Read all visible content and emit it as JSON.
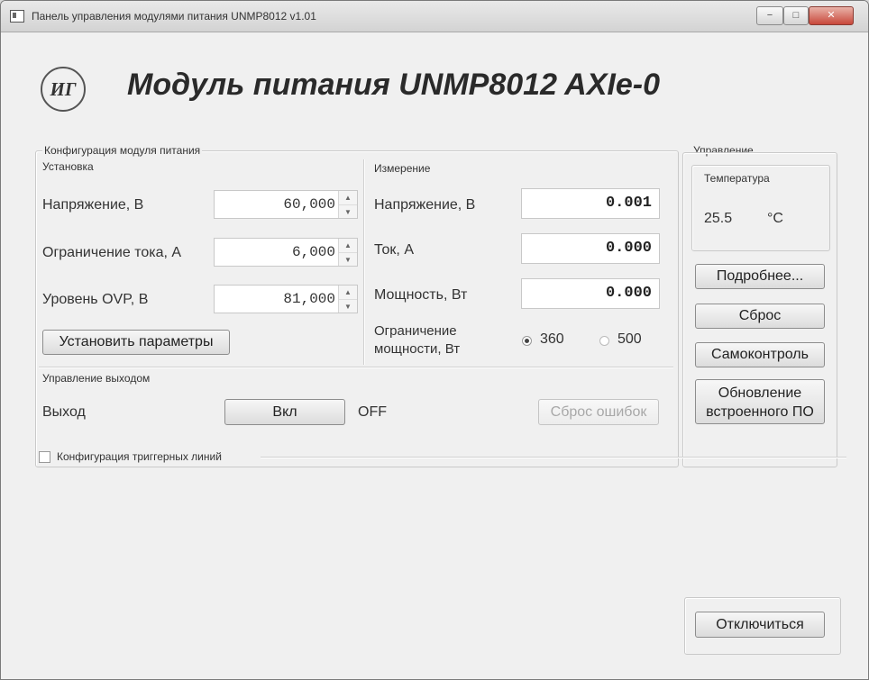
{
  "window": {
    "title": "Панель управления модулями питания UNMP8012 v1.01",
    "minimize_glyph": "−",
    "maximize_glyph": "□",
    "close_glyph": "✕"
  },
  "header": {
    "logo_text": "ИГ",
    "title": "Модуль питания UNMP8012 AXIe-0"
  },
  "config": {
    "group_label": "Конфигурация модуля питания",
    "setup": {
      "label": "Установка",
      "voltage_label": "Напряжение, В",
      "voltage_value": "60,000",
      "current_limit_label": "Ограничение тока, А",
      "current_limit_value": "6,000",
      "ovp_label": "Уровень OVP, В",
      "ovp_value": "81,000",
      "apply_button": "Установить параметры"
    },
    "measurement": {
      "label": "Измерение",
      "voltage_label": "Напряжение, В",
      "voltage_value": "0.001",
      "current_label": "Ток, А",
      "current_value": "0.000",
      "power_label": "Мощность, Вт",
      "power_value": "0.000",
      "power_limit_label_1": "Ограничение",
      "power_limit_label_2": "мощности, Вт",
      "power_limit_options": [
        "360",
        "500"
      ],
      "power_limit_selected": "360"
    },
    "output": {
      "label": "Управление выходом",
      "output_label": "Выход",
      "on_button": "Вкл",
      "state": "OFF",
      "reset_errors_button": "Сброс ошибок"
    }
  },
  "control": {
    "label": "Управление",
    "temperature": {
      "label": "Температура",
      "value": "25.5",
      "unit": "°C"
    },
    "details_button": "Подробнее...",
    "reset_button": "Сброс",
    "selftest_button": "Самоконтроль",
    "firmware_button_line1": "Обновление",
    "firmware_button_line2": "встроенного ПО"
  },
  "trigger": {
    "checkbox_label": "Конфигурация триггерных линий",
    "checked": false
  },
  "disconnect_button": "Отключиться"
}
